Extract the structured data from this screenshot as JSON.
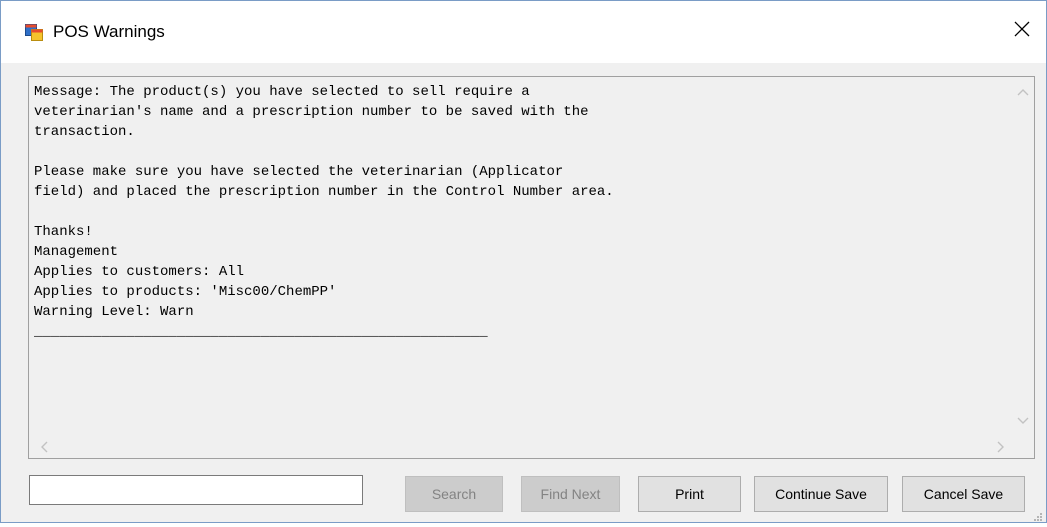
{
  "window": {
    "title": "POS Warnings",
    "icon": "app-window-icon",
    "close_icon": "close-icon"
  },
  "message": {
    "text": "Message: The product(s) you have selected to sell require a\nveterinarian's name and a prescription number to be saved with the\ntransaction.\n\nPlease make sure you have selected the veterinarian (Applicator\nfield) and placed the prescription number in the Control Number area.\n\nThanks!\nManagement\nApplies to customers: All\nApplies to products: 'Misc00/ChemPP'\nWarning Level: Warn\n______________________________________________________"
  },
  "search": {
    "value": "",
    "placeholder": ""
  },
  "buttons": {
    "search": "Search",
    "find_next": "Find Next",
    "print": "Print",
    "continue_save": "Continue Save",
    "cancel_save": "Cancel Save"
  },
  "colors": {
    "window_border": "#7a9cc6",
    "dialog_background": "#f0f0f0",
    "button_background": "#e1e1e1",
    "disabled_text": "#838383"
  }
}
